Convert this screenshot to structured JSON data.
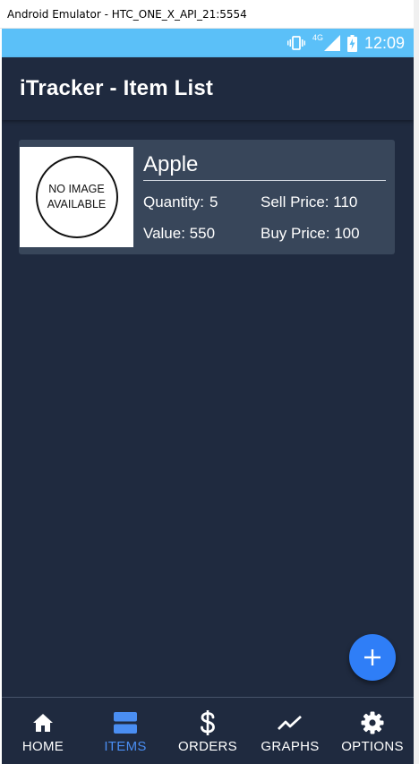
{
  "window": {
    "title": "Android Emulator - HTC_ONE_X_API_21:5554"
  },
  "status_bar": {
    "network": "4G",
    "time": "12:09"
  },
  "app_bar": {
    "title": "iTracker - Item List"
  },
  "items": [
    {
      "name": "Apple",
      "image_placeholder_line1": "NO IMAGE",
      "image_placeholder_line2": "AVAILABLE",
      "quantity_label": "Quantity:",
      "quantity_value": "5",
      "sell_price": "Sell Price: 110",
      "value": "Value: 550",
      "buy_price": "Buy Price: 100"
    }
  ],
  "fab": {
    "icon": "plus-icon"
  },
  "bottom_nav": [
    {
      "label": "HOME",
      "icon": "home-icon",
      "active": false
    },
    {
      "label": "ITEMS",
      "icon": "items-icon",
      "active": true
    },
    {
      "label": "ORDERS",
      "icon": "dollar-icon",
      "active": false
    },
    {
      "label": "GRAPHS",
      "icon": "trending-up-icon",
      "active": false
    },
    {
      "label": "OPTIONS",
      "icon": "gear-icon",
      "active": false
    }
  ],
  "colors": {
    "background": "#1f2a3f",
    "card": "#38465a",
    "status_bar": "#5bc0f8",
    "accent": "#2f7ef7",
    "active_nav": "#4a8ef2"
  }
}
